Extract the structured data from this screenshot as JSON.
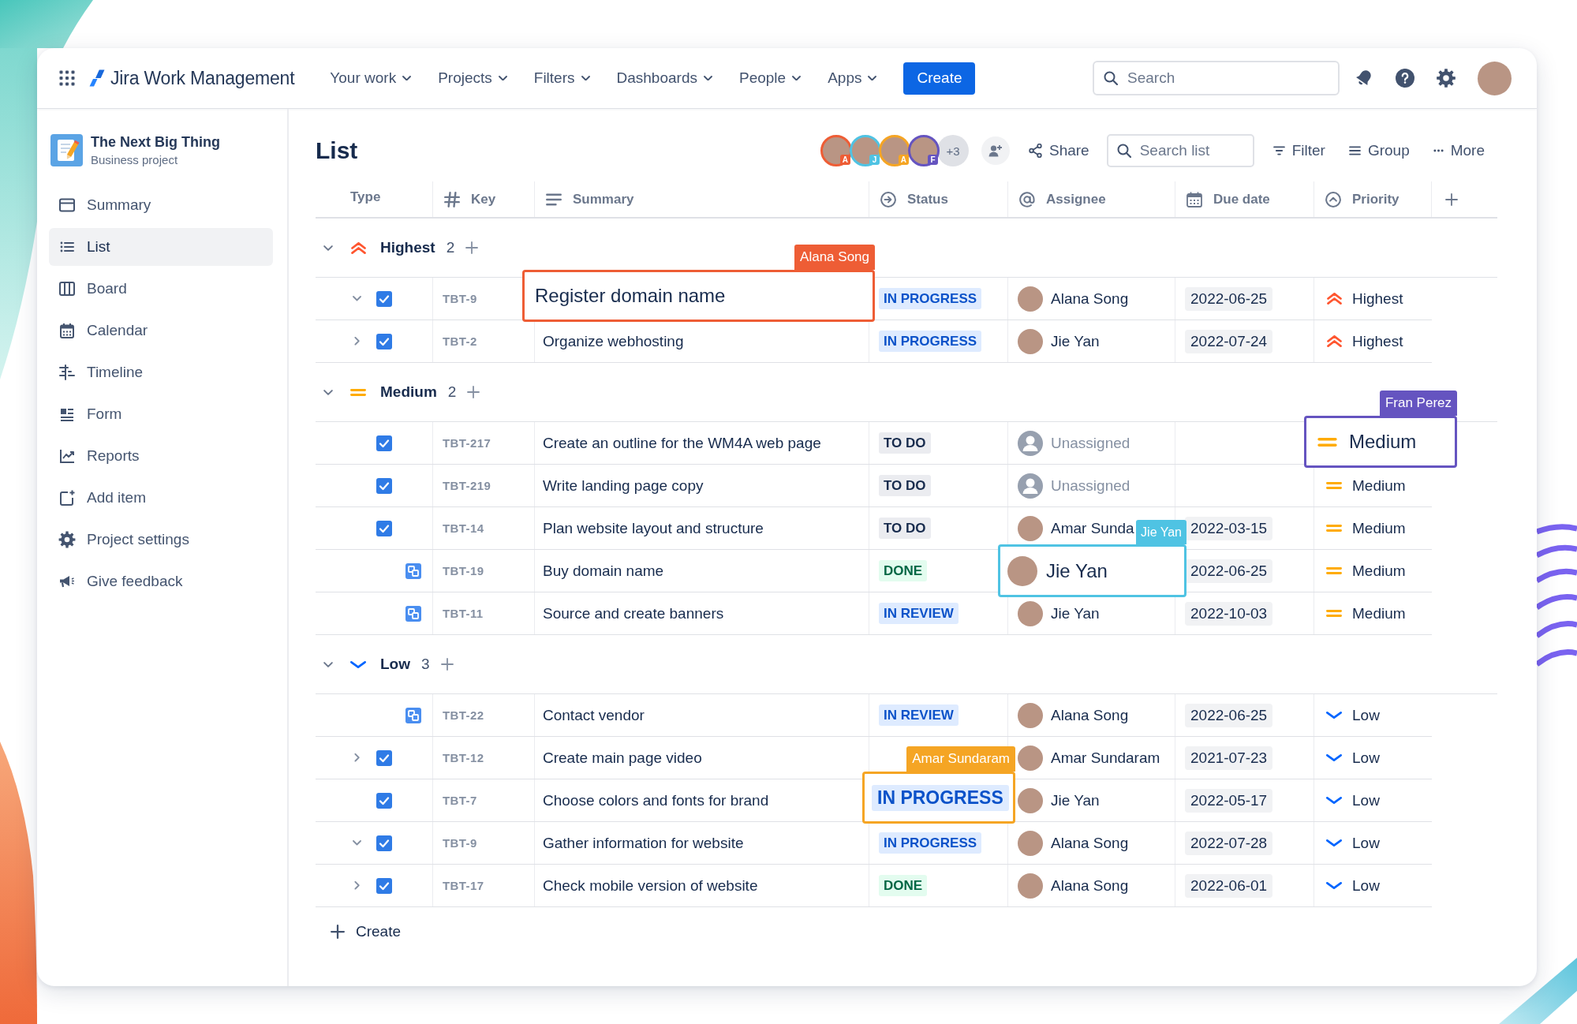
{
  "top_nav": {
    "product": "Jira Work Management",
    "menus": [
      {
        "label": "Your work"
      },
      {
        "label": "Projects"
      },
      {
        "label": "Filters"
      },
      {
        "label": "Dashboards"
      },
      {
        "label": "People"
      },
      {
        "label": "Apps"
      }
    ],
    "create_button": "Create",
    "search": {
      "placeholder": "Search"
    }
  },
  "sidebar": {
    "project": {
      "name": "The Next Big Thing",
      "type": "Business project"
    },
    "items": [
      {
        "label": "Summary",
        "selected": false
      },
      {
        "label": "List",
        "selected": true
      },
      {
        "label": "Board",
        "selected": false
      },
      {
        "label": "Calendar",
        "selected": false
      },
      {
        "label": "Timeline",
        "selected": false
      },
      {
        "label": "Form",
        "selected": false
      },
      {
        "label": "Reports",
        "selected": false
      },
      {
        "label": "Add item",
        "selected": false
      },
      {
        "label": "Project settings",
        "selected": false
      },
      {
        "label": "Give feedback",
        "selected": false
      }
    ]
  },
  "toolbar": {
    "title": "List",
    "collaborators": [
      {
        "initial": "A",
        "color": "#ee5d35"
      },
      {
        "initial": "J",
        "color": "#4fc3e3"
      },
      {
        "initial": "A",
        "color": "#f5a524"
      },
      {
        "initial": "F",
        "color": "#6554c0"
      }
    ],
    "more_collaborators": "+3",
    "share": "Share",
    "search": {
      "placeholder": "Search list"
    },
    "filter": "Filter",
    "group": "Group",
    "more": "More"
  },
  "table": {
    "columns": [
      {
        "label": "Type"
      },
      {
        "label": "Key"
      },
      {
        "label": "Summary"
      },
      {
        "label": "Status"
      },
      {
        "label": "Assignee"
      },
      {
        "label": "Due date"
      },
      {
        "label": "Priority"
      }
    ],
    "groups": [
      {
        "label": "Highest",
        "kind": "highest",
        "count": "2",
        "expanded": true,
        "rows": [
          {
            "kind": "task",
            "checked": true,
            "toggle": {
              "expanded": true
            },
            "key": "TBT-9",
            "summary": "Register domain name",
            "status": {
              "label": "IN PROGRESS",
              "kind": "progress"
            },
            "assignee": {
              "name": "Alana Song",
              "assigned": true
            },
            "due": "2022-06-25",
            "priority": "Highest",
            "cursor": {
              "kind": "summary",
              "name": "Alana Song",
              "color": "#ee5d35"
            }
          },
          {
            "kind": "task",
            "checked": true,
            "toggle": {
              "expanded": false
            },
            "key": "TBT-2",
            "summary": "Organize webhosting",
            "status": {
              "label": "IN PROGRESS",
              "kind": "progress"
            },
            "assignee": {
              "name": "Jie Yan",
              "assigned": true
            },
            "due": "2022-07-24",
            "priority": "Highest"
          }
        ]
      },
      {
        "label": "Medium",
        "kind": "medium",
        "count": "2",
        "expanded": true,
        "rows": [
          {
            "kind": "task",
            "checked": true,
            "key": "TBT-217",
            "summary": "Create an outline for the WM4A web page",
            "status": {
              "label": "TO DO",
              "kind": "todo"
            },
            "assignee": {
              "name": "Unassigned",
              "assigned": false
            },
            "priority": "Medium",
            "cursor": {
              "kind": "priority",
              "name": "Fran Perez",
              "color": "#6554c0"
            }
          },
          {
            "kind": "task",
            "checked": true,
            "key": "TBT-219",
            "summary": "Write landing page copy",
            "status": {
              "label": "TO DO",
              "kind": "todo"
            },
            "assignee": {
              "name": "Unassigned",
              "assigned": false
            },
            "priority": "Medium"
          },
          {
            "kind": "task",
            "checked": true,
            "key": "TBT-14",
            "summary": "Plan website layout and structure",
            "status": {
              "label": "TO DO",
              "kind": "todo"
            },
            "assignee": {
              "name": "Amar Sunda",
              "assigned": true
            },
            "due": "2022-03-15",
            "priority": "Medium"
          },
          {
            "kind": "subtask",
            "key": "TBT-19",
            "summary": "Buy domain name",
            "status": {
              "label": "DONE",
              "kind": "done"
            },
            "assignee": {
              "name": "Jie Yan",
              "assigned": true
            },
            "due": "2022-06-25",
            "priority": "Medium",
            "cursor": {
              "kind": "assignee",
              "name": "Jie Yan",
              "color": "#4fc3e3"
            }
          },
          {
            "kind": "subtask",
            "key": "TBT-11",
            "summary": "Source and create banners",
            "status": {
              "label": "IN REVIEW",
              "kind": "progress"
            },
            "assignee": {
              "name": "Jie Yan",
              "assigned": true
            },
            "due": "2022-10-03",
            "priority": "Medium"
          }
        ]
      },
      {
        "label": "Low",
        "kind": "low",
        "count": "3",
        "expanded": true,
        "rows": [
          {
            "kind": "subtask",
            "key": "TBT-22",
            "summary": "Contact vendor",
            "status": {
              "label": "IN REVIEW",
              "kind": "progress"
            },
            "assignee": {
              "name": "Alana Song",
              "assigned": true
            },
            "due": "2022-06-25",
            "priority": "Low"
          },
          {
            "kind": "task",
            "checked": true,
            "toggle": {
              "expanded": false
            },
            "key": "TBT-12",
            "summary": "Create main page video",
            "assignee": {
              "name": "Amar Sundaram",
              "assigned": true
            },
            "due": "2021-07-23",
            "priority": "Low"
          },
          {
            "kind": "task",
            "checked": true,
            "key": "TBT-7",
            "summary": "Choose colors and fonts for brand",
            "status": {
              "label": "IN PROGRESS",
              "kind": "progress"
            },
            "assignee": {
              "name": "Jie Yan",
              "assigned": true
            },
            "due": "2022-05-17",
            "priority": "Low",
            "cursor": {
              "kind": "status",
              "name": "Amar Sundaram",
              "color": "#f5a524"
            }
          },
          {
            "kind": "task",
            "checked": true,
            "toggle": {
              "expanded": true
            },
            "key": "TBT-9",
            "summary": "Gather information for website",
            "status": {
              "label": "IN PROGRESS",
              "kind": "progress"
            },
            "assignee": {
              "name": "Alana Song",
              "assigned": true
            },
            "due": "2022-07-28",
            "priority": "Low"
          },
          {
            "kind": "task",
            "checked": true,
            "toggle": {
              "expanded": false
            },
            "key": "TBT-17",
            "summary": "Check mobile version of website",
            "status": {
              "label": "DONE",
              "kind": "done"
            },
            "assignee": {
              "name": "Alana Song",
              "assigned": true
            },
            "due": "2022-06-01",
            "priority": "Low"
          }
        ]
      }
    ]
  },
  "create": "Create"
}
